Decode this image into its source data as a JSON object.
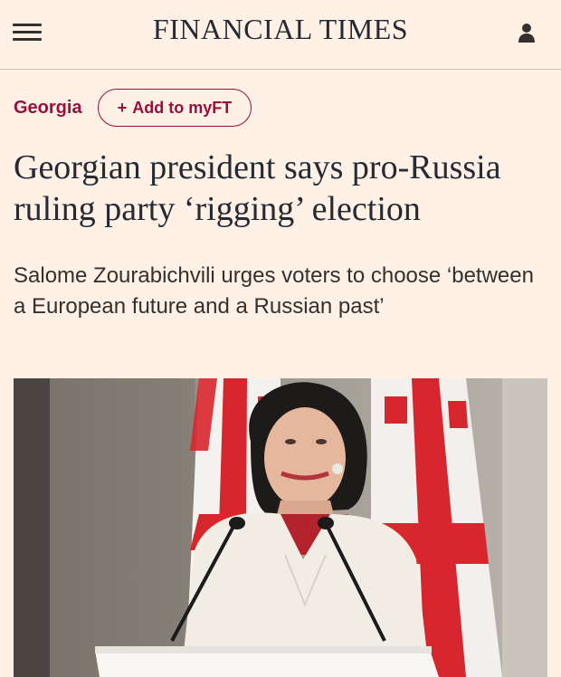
{
  "header": {
    "brand": "FINANCIAL TIMES",
    "menu_icon": "hamburger-menu-icon",
    "account_icon": "user-icon"
  },
  "article": {
    "topic": "Georgia",
    "myft_plus": "+",
    "myft_label": "Add to myFT",
    "headline": "Georgian president says pro-Russia ruling party ‘rigging’ election",
    "standfirst": "Salome Zourabichvili urges voters to choose ‘between a European future and a Russian past’"
  },
  "colors": {
    "background": "#fff1e5",
    "accent": "#990f3d",
    "text": "#262a33"
  }
}
